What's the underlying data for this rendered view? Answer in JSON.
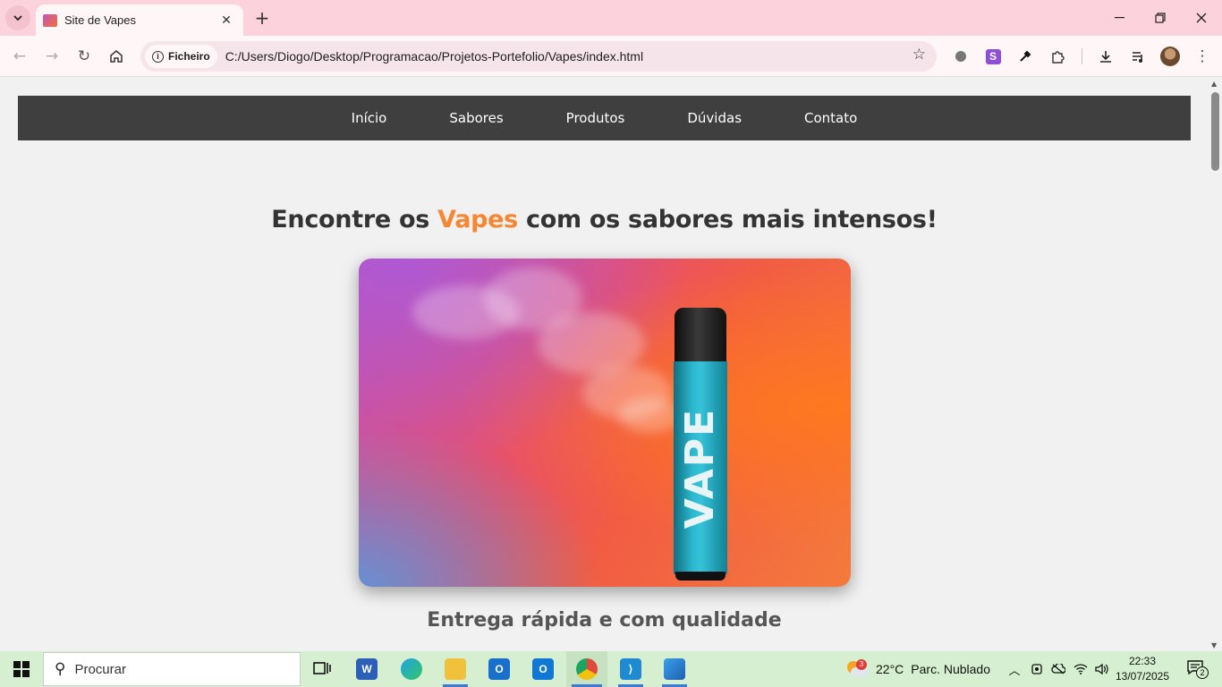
{
  "browser": {
    "tab_title": "Site de Vapes",
    "address_chip": "Ficheiro",
    "url": "C:/Users/Diogo/Desktop/Programacao/Projetos-Portefolio/Vapes/index.html",
    "ext_s_label": "S"
  },
  "site": {
    "nav": [
      "Início",
      "Sabores",
      "Produtos",
      "Dúvidas",
      "Contato"
    ],
    "headline_before": "Encontre os ",
    "headline_highlight": "Vapes",
    "headline_after": " com os sabores mais intensos!",
    "hero_label": "VAPE",
    "subheading": "Entrega rápida e com qualidade",
    "accent_color": "#f58634"
  },
  "taskbar": {
    "search_placeholder": "Procurar",
    "weather_temp": "22°C",
    "weather_desc": "Parc. Nublado",
    "weather_badge": "3",
    "time": "22:33",
    "date": "13/07/2025",
    "notification_count": "2"
  }
}
